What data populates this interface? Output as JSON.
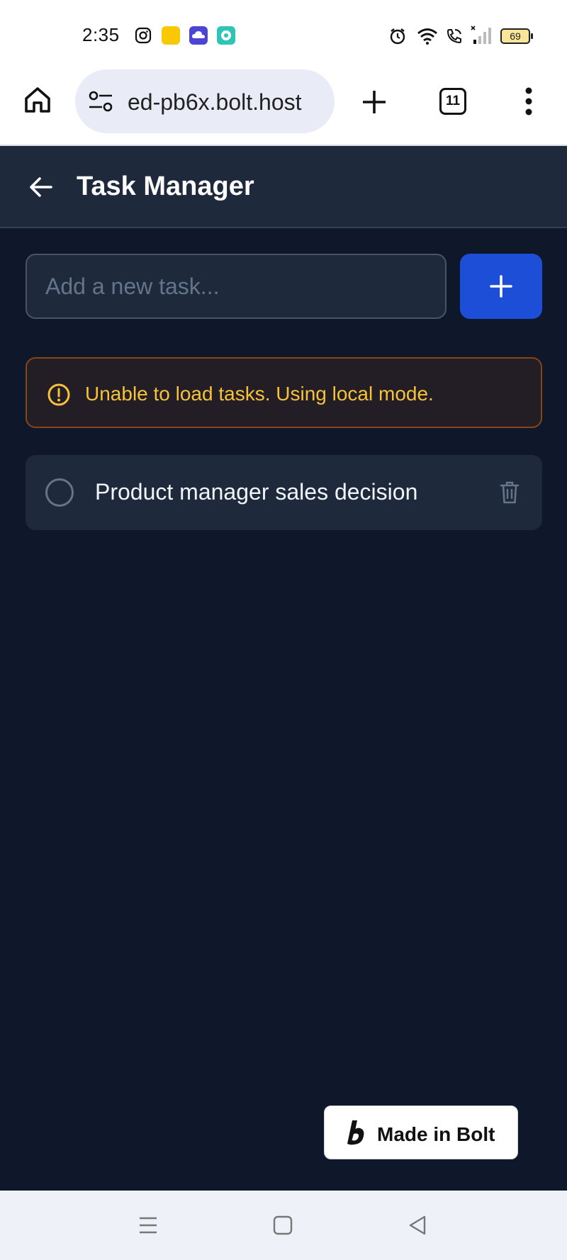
{
  "status_bar": {
    "time": "2:35",
    "battery_level": "69",
    "icons": [
      "instagram-icon",
      "blinkit-icon",
      "cloud-app-icon",
      "chat-app-icon",
      "alarm-icon",
      "wifi-icon",
      "wifi-call-icon",
      "signal-icon"
    ]
  },
  "browser": {
    "url": "ed-pb6x.bolt.host",
    "tab_count": "11"
  },
  "header": {
    "title": "Task Manager"
  },
  "task_input": {
    "placeholder": "Add a new task..."
  },
  "warning": {
    "message": "Unable to load tasks. Using local mode."
  },
  "tasks": [
    {
      "text": "Product manager sales decision",
      "completed": false
    }
  ],
  "bolt_badge": {
    "label": "Made in Bolt"
  },
  "colors": {
    "background": "#0f172a",
    "surface": "#1e293b",
    "accent": "#1d4ed8",
    "warning": "#f6c23a"
  }
}
